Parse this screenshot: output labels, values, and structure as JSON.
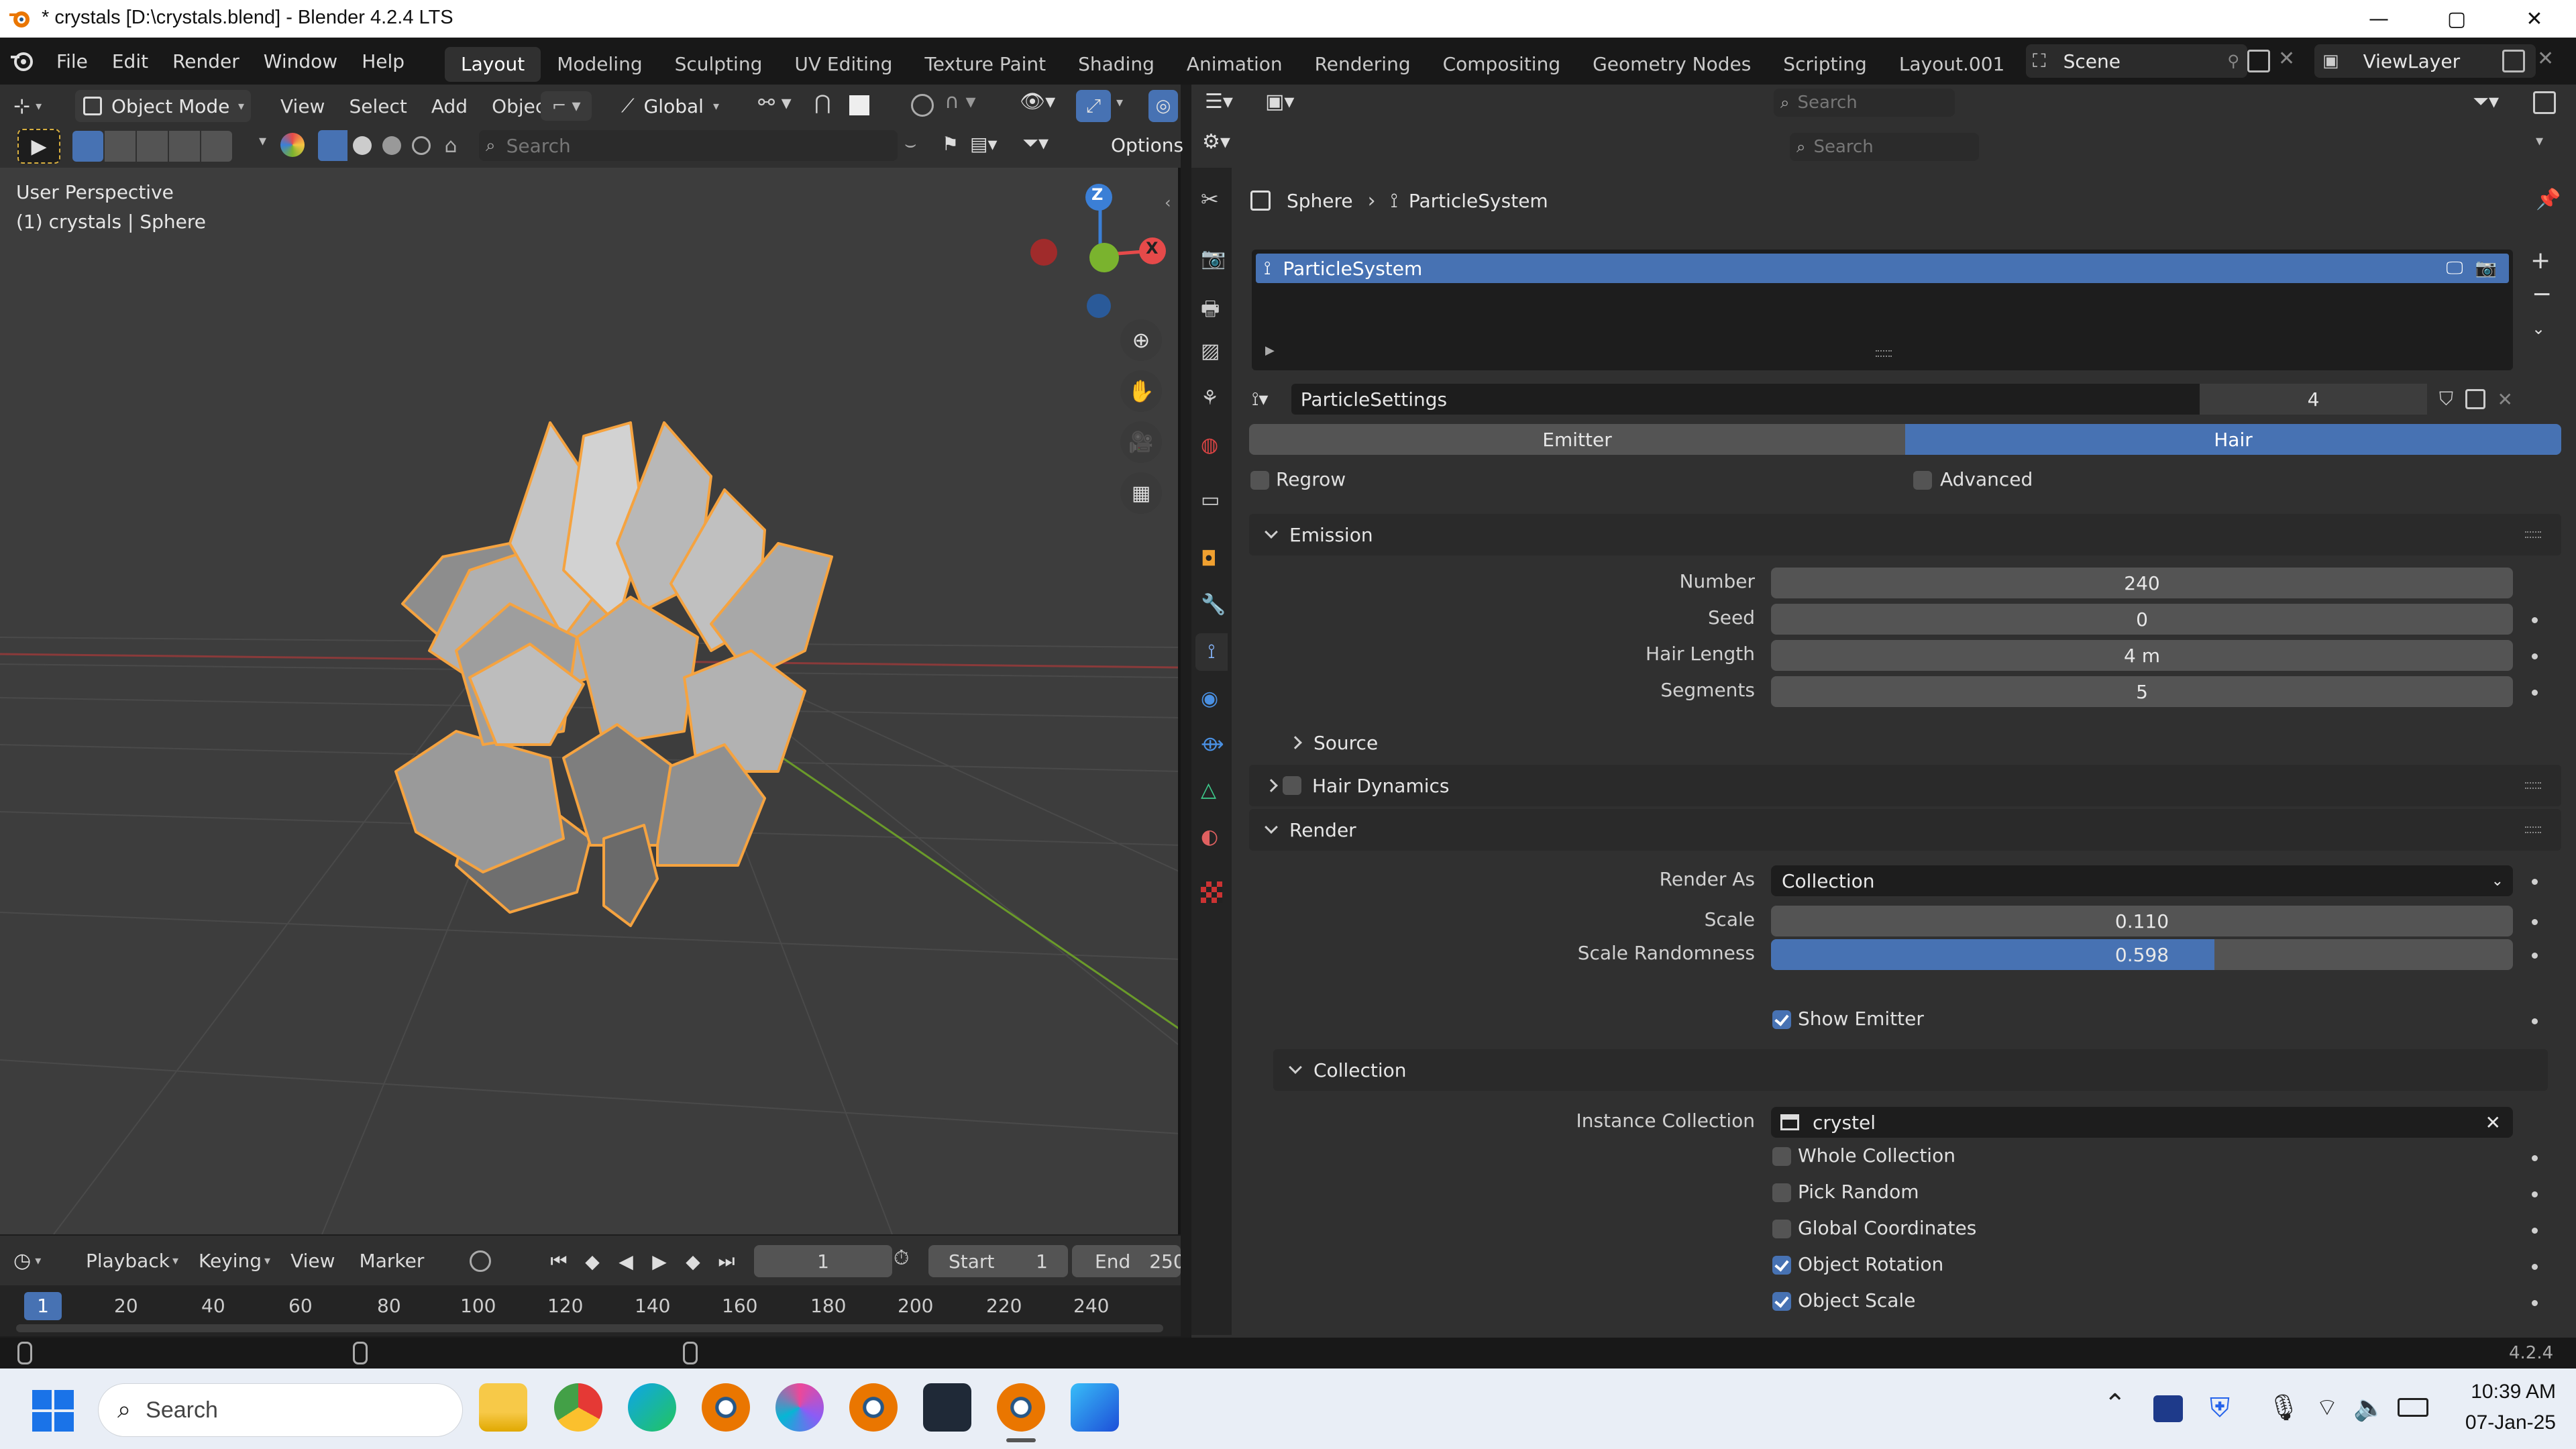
{
  "window": {
    "title": "* crystals [D:\\crystals.blend] - Blender 4.2.4 LTS",
    "controls": [
      "—",
      "▢",
      "✕"
    ]
  },
  "menus": [
    "File",
    "Edit",
    "Render",
    "Window",
    "Help"
  ],
  "workspaces": [
    "Layout",
    "Modeling",
    "Sculpting",
    "UV Editing",
    "Texture Paint",
    "Shading",
    "Animation",
    "Rendering",
    "Compositing",
    "Geometry Nodes",
    "Scripting",
    "Layout.001"
  ],
  "active_workspace": "Layout",
  "scene": {
    "name": "Scene",
    "view_layer": "ViewLayer"
  },
  "viewport": {
    "mode": "Object Mode",
    "menus": [
      "View",
      "Select",
      "Add",
      "Object"
    ],
    "transform_orientation": "Global",
    "search_placeholder": "Search",
    "options_label": "Options",
    "info_line1": "User Perspective",
    "info_line2": "(1) crystals | Sphere",
    "gizmo": {
      "z": "Z",
      "x": "X"
    }
  },
  "outliner": {
    "search_placeholder": "Search"
  },
  "properties": {
    "search_placeholder": "Search",
    "breadcrumb": {
      "object": "Sphere",
      "system": "ParticleSystem"
    },
    "particle_system_item": "ParticleSystem",
    "settings_name": "ParticleSettings",
    "users": "4",
    "type_tabs": {
      "emitter": "Emitter",
      "hair": "Hair",
      "active": "Hair"
    },
    "regrow": {
      "label": "Regrow",
      "checked": false
    },
    "advanced": {
      "label": "Advanced",
      "checked": false
    },
    "emission": {
      "title": "Emission",
      "number_label": "Number",
      "number": "240",
      "seed_label": "Seed",
      "seed": "0",
      "hair_length_label": "Hair Length",
      "hair_length": "4 m",
      "segments_label": "Segments",
      "segments": "5",
      "source_label": "Source"
    },
    "hair_dynamics": {
      "title": "Hair Dynamics",
      "checked": false
    },
    "render": {
      "title": "Render",
      "render_as_label": "Render As",
      "render_as": "Collection",
      "scale_label": "Scale",
      "scale": "0.110",
      "scale_rand_label": "Scale Randomness",
      "scale_rand": "0.598",
      "scale_rand_fraction": 0.598,
      "show_emitter": {
        "label": "Show Emitter",
        "checked": true
      }
    },
    "collection": {
      "title": "Collection",
      "instance_label": "Instance Collection",
      "instance_value": "crystel",
      "whole_collection": {
        "label": "Whole Collection",
        "checked": false
      },
      "pick_random": {
        "label": "Pick Random",
        "checked": false
      },
      "global_coordinates": {
        "label": "Global Coordinates",
        "checked": false
      },
      "object_rotation": {
        "label": "Object Rotation",
        "checked": true
      },
      "object_scale": {
        "label": "Object Scale",
        "checked": true
      }
    }
  },
  "timeline": {
    "menus": [
      "Playback",
      "Keying",
      "View",
      "Marker"
    ],
    "current_frame": "1",
    "start_label": "Start",
    "start": "1",
    "end_label": "End",
    "end": "250",
    "ruler": [
      "1",
      "20",
      "40",
      "60",
      "80",
      "100",
      "120",
      "140",
      "160",
      "180",
      "200",
      "220",
      "240"
    ]
  },
  "status": {
    "version": "4.2.4"
  },
  "taskbar": {
    "search_placeholder": "Search",
    "time": "10:39 AM",
    "date": "07-Jan-25"
  },
  "colors": {
    "accent_blue": "#4772b3",
    "selection_orange": "#f5a340",
    "axis_red": "#e64a4a",
    "axis_green": "#7ab32e",
    "axis_blue": "#3b7fd6"
  }
}
